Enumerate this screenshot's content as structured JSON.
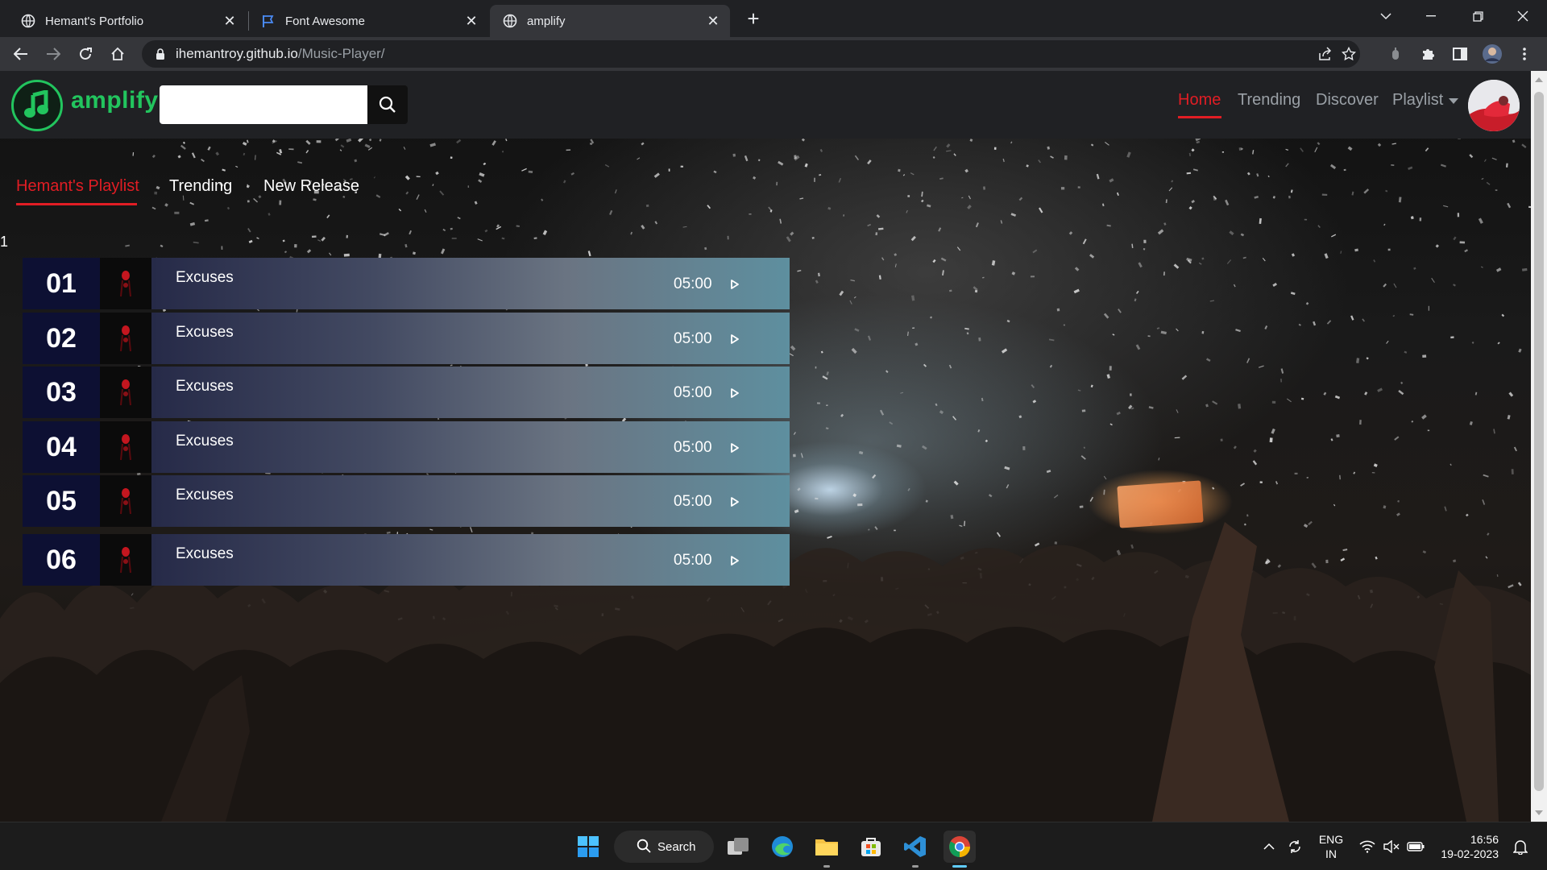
{
  "browser": {
    "tabs": [
      {
        "title": "Hemant's Portfolio",
        "active": false,
        "icon": "globe-icon"
      },
      {
        "title": "Font Awesome",
        "active": false,
        "icon": "flag-icon"
      },
      {
        "title": "amplify",
        "active": true,
        "icon": "globe-icon"
      }
    ],
    "url_host": "ihemantroy.github.io",
    "url_path": "/Music-Player/"
  },
  "app": {
    "logo_text": "amplify",
    "search": {
      "value": "",
      "placeholder": ""
    },
    "nav": [
      {
        "label": "Home",
        "active": true
      },
      {
        "label": "Trending",
        "active": false
      },
      {
        "label": "Discover",
        "active": false
      },
      {
        "label": "Playlist",
        "active": false,
        "dropdown": true
      }
    ],
    "playlist_tabs": [
      {
        "label": "Hemant's Playlist",
        "active": true
      },
      {
        "label": "Trending",
        "active": false
      },
      {
        "label": "New Release",
        "active": false
      }
    ],
    "stray_label": "1",
    "tracks": [
      {
        "number": "01",
        "title": "Excuses",
        "duration": "05:00"
      },
      {
        "number": "02",
        "title": "Excuses",
        "duration": "05:00"
      },
      {
        "number": "03",
        "title": "Excuses",
        "duration": "05:00"
      },
      {
        "number": "04",
        "title": "Excuses",
        "duration": "05:00"
      },
      {
        "number": "05",
        "title": "Excuses",
        "duration": "05:00"
      },
      {
        "number": "06",
        "title": "Excuses",
        "duration": "05:00"
      }
    ],
    "colors": {
      "accent": "#e11d24",
      "brand": "#22c55e",
      "number_bg": "#0d1033"
    }
  },
  "taskbar": {
    "search_label": "Search",
    "lang_top": "ENG",
    "lang_bottom": "IN",
    "time": "16:56",
    "date": "19-02-2023"
  }
}
